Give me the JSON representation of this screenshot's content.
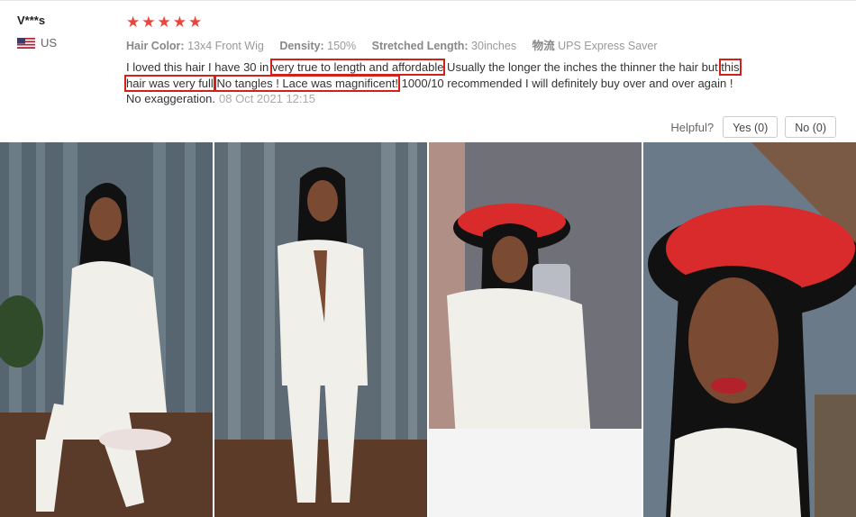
{
  "reviewer": {
    "name": "V***s",
    "country": "US",
    "flag_icon": "us-flag-icon"
  },
  "rating": {
    "stars": 5,
    "star_icon": "star-icon",
    "color": "#e9473c"
  },
  "specs": [
    {
      "key": "Hair Color:",
      "value": "13x4 Front Wig"
    },
    {
      "key": "Density:",
      "value": "150%"
    },
    {
      "key": "Stretched Length:",
      "value": "30inches"
    },
    {
      "key": "物流",
      "value": "UPS Express Saver"
    }
  ],
  "review": {
    "part1": "I loved this hair I have 30 in ",
    "hl1": "very true to length and affordable",
    "part2": " Usually the longer the inches the thinner the hair but ",
    "hl2": "this hair was very full",
    "part3": " ",
    "hl3": "No tangles ! Lace was magnificent!",
    "part4": " 1000/10 recommended I will definitely buy over and over again ! No exaggeration.",
    "date": "08 Oct 2021 12:15",
    "highlight_color": "#d0221b"
  },
  "helpful": {
    "label": "Helpful?",
    "yes": "Yes (0)",
    "no": "No (0)"
  },
  "photos": [
    {
      "name": "review-photo-1"
    },
    {
      "name": "review-photo-2"
    },
    {
      "name": "review-photo-3"
    },
    {
      "name": "review-photo-4"
    }
  ]
}
